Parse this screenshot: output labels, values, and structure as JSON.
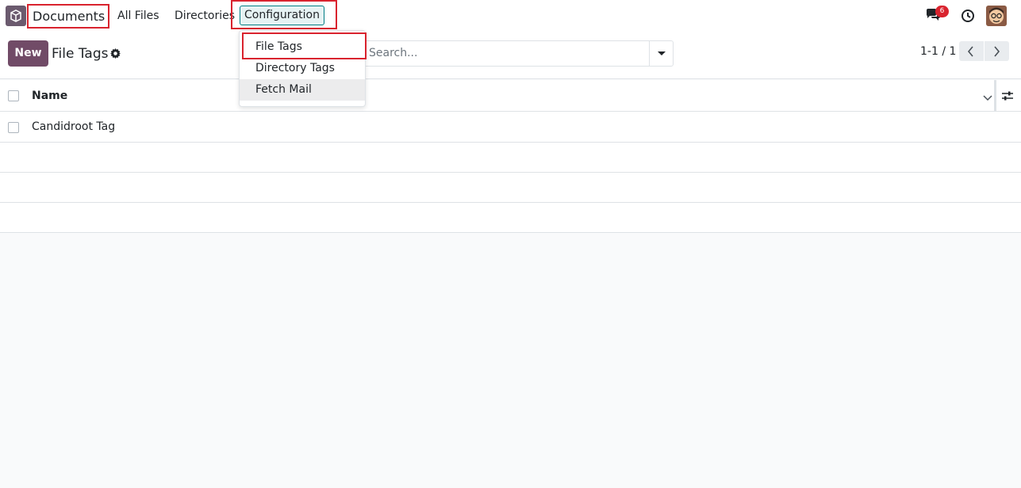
{
  "navbar": {
    "app_name": "Documents",
    "menu": [
      {
        "label": "All Files"
      },
      {
        "label": "Directories"
      },
      {
        "label": "Configuration"
      }
    ],
    "messages_count": "6"
  },
  "control_panel": {
    "new_label": "New",
    "breadcrumb": "File Tags",
    "search_placeholder": "Search...",
    "pager": "1-1 / 1"
  },
  "list": {
    "columns": [
      "Name"
    ],
    "rows": [
      {
        "name": "Candidroot Tag"
      }
    ]
  },
  "configuration_menu": {
    "items": [
      {
        "label": "File Tags"
      },
      {
        "label": "Directory Tags"
      },
      {
        "label": "Fetch Mail"
      }
    ]
  },
  "colors": {
    "brand": "#714b67",
    "accent": "#017e84",
    "highlight_border": "#d9232e",
    "badge": "#d9232e"
  },
  "icons": {
    "app": "documents-app-icon",
    "messages": "chat-icon",
    "activities": "clock-icon",
    "settings": "gear-icon",
    "search_toggle": "caret-down-icon",
    "pager_prev": "chevron-left-icon",
    "pager_next": "chevron-right-icon",
    "column_menu": "chevron-down-icon",
    "optional_columns": "sliders-icon"
  }
}
